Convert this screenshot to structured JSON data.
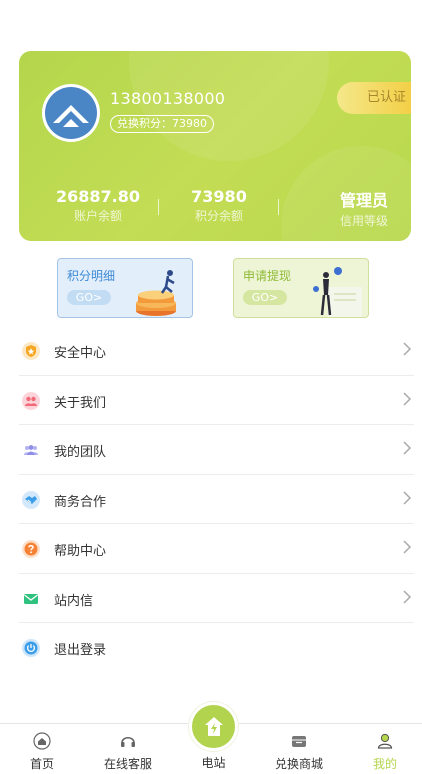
{
  "profile": {
    "phone": "13800138000",
    "points_pill": "兑换积分：73980",
    "verified_label": "已认证",
    "stats": [
      {
        "value": "26887.80",
        "label": "账户余额"
      },
      {
        "value": "73980",
        "label": "积分余额"
      },
      {
        "value": "管理员",
        "label": "信用等级"
      }
    ]
  },
  "promos": [
    {
      "title": "积分明细",
      "go": "GO>"
    },
    {
      "title": "申请提现",
      "go": "GO>"
    }
  ],
  "menu": [
    {
      "label": "安全中心",
      "icon": "shield-icon",
      "color": "#f5a623"
    },
    {
      "label": "关于我们",
      "icon": "people-icon",
      "color": "#f26a7a"
    },
    {
      "label": "我的团队",
      "icon": "team-icon",
      "color": "#8f8fe8"
    },
    {
      "label": "商务合作",
      "icon": "handshake-icon",
      "color": "#3c9ee8"
    },
    {
      "label": "帮助中心",
      "icon": "question-icon",
      "color": "#f58235"
    },
    {
      "label": "站内信",
      "icon": "mail-icon",
      "color": "#2ec27e"
    },
    {
      "label": "退出登录",
      "icon": "power-icon",
      "color": "#3c9ee8"
    }
  ],
  "tabbar": {
    "items": [
      {
        "label": "首页",
        "icon": "home-icon"
      },
      {
        "label": "在线客服",
        "icon": "headset-icon"
      },
      {
        "label": "电站",
        "icon": "power-station-icon"
      },
      {
        "label": "兑换商城",
        "icon": "shop-icon"
      },
      {
        "label": "我的",
        "icon": "user-icon"
      }
    ],
    "active_index": 4,
    "accent": "#b4d64c"
  }
}
